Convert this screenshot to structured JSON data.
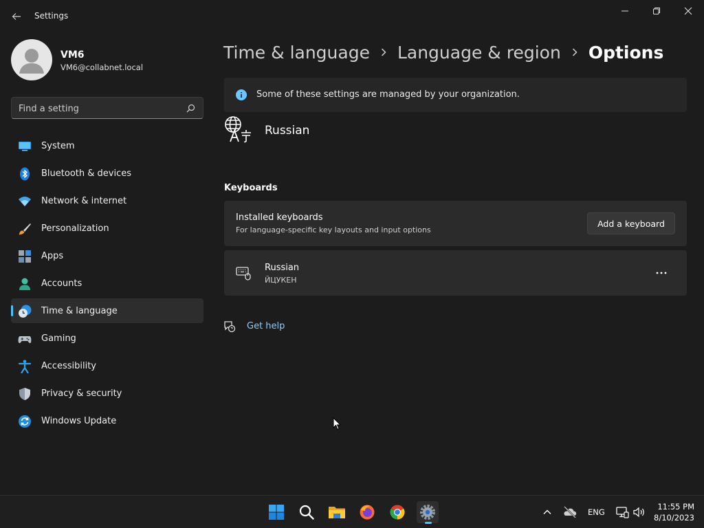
{
  "window": {
    "title": "Settings"
  },
  "user": {
    "name": "VM6",
    "email": "VM6@collabnet.local"
  },
  "search": {
    "placeholder": "Find a setting"
  },
  "sidebar": {
    "items": [
      {
        "label": "System",
        "icon": "system-icon"
      },
      {
        "label": "Bluetooth & devices",
        "icon": "bluetooth-icon"
      },
      {
        "label": "Network & internet",
        "icon": "wifi-icon"
      },
      {
        "label": "Personalization",
        "icon": "brush-icon"
      },
      {
        "label": "Apps",
        "icon": "apps-icon"
      },
      {
        "label": "Accounts",
        "icon": "person-icon"
      },
      {
        "label": "Time & language",
        "icon": "clock-globe-icon",
        "selected": true
      },
      {
        "label": "Gaming",
        "icon": "gamepad-icon"
      },
      {
        "label": "Accessibility",
        "icon": "accessibility-icon"
      },
      {
        "label": "Privacy & security",
        "icon": "shield-icon"
      },
      {
        "label": "Windows Update",
        "icon": "update-icon"
      }
    ]
  },
  "breadcrumb": {
    "level1": "Time & language",
    "level2": "Language & region",
    "current": "Options"
  },
  "info_bar": {
    "text": "Some of these settings are managed by your organization."
  },
  "language": {
    "name": "Russian"
  },
  "keyboards": {
    "section_title": "Keyboards",
    "installed_title": "Installed keyboards",
    "installed_desc": "For language-specific key layouts and input options",
    "add_button": "Add a keyboard",
    "items": [
      {
        "name": "Russian",
        "layout": "ЙЦУКЕН"
      }
    ]
  },
  "help": {
    "label": "Get help"
  },
  "taskbar": {
    "apps": [
      "start-icon",
      "search-icon",
      "file-explorer-icon",
      "firefox-icon",
      "chrome-icon",
      "settings-icon"
    ],
    "tray": {
      "language": "ENG",
      "time": "11:55 PM",
      "date": "8/10/2023"
    }
  },
  "colors": {
    "accent": "#4cc2ff",
    "background": "#1c1c1c",
    "card": "#2b2b2b",
    "link": "#8ecdf8"
  }
}
